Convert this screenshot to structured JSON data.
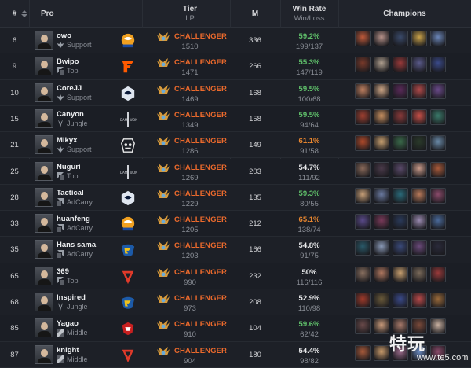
{
  "header": {
    "rank": "#",
    "pro": "Pro",
    "tier": "Tier",
    "tier_sub": "LP",
    "m": "M",
    "winrate": "Win Rate",
    "winrate_sub": "Win/Loss",
    "champions": "Champions"
  },
  "colors": {
    "challenger": "#ec6a2c",
    "green": "#5fbf6a",
    "orange": "#e8862f",
    "white": "#e7e8ea"
  },
  "rows": [
    {
      "rank": "6",
      "name": "owo",
      "role": "Support",
      "role_icon": "support-icon",
      "team_icon": "suning-logo-icon",
      "tier": "CHALLENGER",
      "lp": "1510",
      "m": "336",
      "wr": "59.2%",
      "wl": "199/137",
      "wr_color": "green",
      "champs": [
        "#c05a3a",
        "#b7928a",
        "#3a4a6a",
        "#c9a24a",
        "#6b86b8"
      ]
    },
    {
      "rank": "9",
      "name": "Bwipo",
      "role": "Top",
      "role_icon": "top-icon",
      "team_icon": "fnatic-logo-icon",
      "tier": "CHALLENGER",
      "lp": "1471",
      "m": "266",
      "wr": "55.3%",
      "wl": "147/119",
      "wr_color": "green",
      "champs": [
        "#7a3a2a",
        "#b0a090",
        "#9a3a3a",
        "#5a5a8a",
        "#3a4a8a"
      ]
    },
    {
      "rank": "10",
      "name": "CoreJJ",
      "role": "Support",
      "role_icon": "support-icon",
      "team_icon": "liquid-logo-icon",
      "tier": "CHALLENGER",
      "lp": "1469",
      "m": "168",
      "wr": "59.5%",
      "wl": "100/68",
      "wr_color": "green",
      "champs": [
        "#c08060",
        "#d0a888",
        "#5a2a5a",
        "#b04a4a",
        "#6a4a8a"
      ]
    },
    {
      "rank": "15",
      "name": "Canyon",
      "role": "Jungle",
      "role_icon": "jungle-icon",
      "team_icon": "damwon-logo-icon",
      "tier": "CHALLENGER",
      "lp": "1349",
      "m": "158",
      "wr": "59.5%",
      "wl": "94/64",
      "wr_color": "green",
      "champs": [
        "#a04030",
        "#c89060",
        "#8a3a3a",
        "#c85048",
        "#3a7a6a"
      ]
    },
    {
      "rank": "21",
      "name": "Mikyx",
      "role": "Support",
      "role_icon": "support-icon",
      "team_icon": "g2-logo-icon",
      "tier": "CHALLENGER",
      "lp": "1286",
      "m": "149",
      "wr": "61.1%",
      "wl": "91/58",
      "wr_color": "orange",
      "champs": [
        "#b04a2a",
        "#c8a070",
        "#3a6a4a",
        "#2a3a2a",
        "#6a8aa8"
      ]
    },
    {
      "rank": "25",
      "name": "Nuguri",
      "role": "Top",
      "role_icon": "top-icon",
      "team_icon": "damwon-logo-icon",
      "tier": "CHALLENGER",
      "lp": "1269",
      "m": "203",
      "wr": "54.7%",
      "wl": "111/92",
      "wr_color": "white",
      "champs": [
        "#8a6a5a",
        "#4a3a4a",
        "#5a4a6a",
        "#c89a8a",
        "#a85a3a"
      ]
    },
    {
      "rank": "28",
      "name": "Tactical",
      "role": "AdCarry",
      "role_icon": "adcarry-icon",
      "team_icon": "liquid-logo-icon",
      "tier": "CHALLENGER",
      "lp": "1229",
      "m": "135",
      "wr": "59.3%",
      "wl": "80/55",
      "wr_color": "green",
      "champs": [
        "#c8a078",
        "#6a7aa0",
        "#2a6a7a",
        "#b87a5a",
        "#8a4a6a"
      ]
    },
    {
      "rank": "33",
      "name": "huanfeng",
      "role": "AdCarry",
      "role_icon": "adcarry-icon",
      "team_icon": "suning-logo-icon",
      "tier": "CHALLENGER",
      "lp": "1205",
      "m": "212",
      "wr": "65.1%",
      "wl": "138/74",
      "wr_color": "orange",
      "champs": [
        "#5a4a8a",
        "#7a3a5a",
        "#2a3a5a",
        "#9a8ab0",
        "#4a6a9a"
      ]
    },
    {
      "rank": "35",
      "name": "Hans sama",
      "role": "AdCarry",
      "role_icon": "adcarry-icon",
      "team_icon": "rogue-logo-icon",
      "tier": "CHALLENGER",
      "lp": "1203",
      "m": "166",
      "wr": "54.8%",
      "wl": "91/75",
      "wr_color": "white",
      "champs": [
        "#2a5a6a",
        "#8a9ab8",
        "#3a4a7a",
        "#6a4a7a",
        "#2a2a3a"
      ]
    },
    {
      "rank": "65",
      "name": "369",
      "role": "Top",
      "role_icon": "top-icon",
      "team_icon": "tes-logo-icon",
      "tier": "CHALLENGER",
      "lp": "990",
      "m": "232",
      "wr": "50%",
      "wl": "116/116",
      "wr_color": "white",
      "champs": [
        "#8a7060",
        "#b07860",
        "#c8a070",
        "#7a6a5a",
        "#9a3a3a"
      ]
    },
    {
      "rank": "68",
      "name": "Inspired",
      "role": "Jungle",
      "role_icon": "jungle-icon",
      "team_icon": "rogue-logo-icon",
      "tier": "CHALLENGER",
      "lp": "973",
      "m": "208",
      "wr": "52.9%",
      "wl": "110/98",
      "wr_color": "white",
      "champs": [
        "#a03a2a",
        "#6a5a3a",
        "#3a4a8a",
        "#b84a4a",
        "#9a6a3a"
      ]
    },
    {
      "rank": "85",
      "name": "Yagao",
      "role": "Middle",
      "role_icon": "middle-icon",
      "team_icon": "jdg-logo-icon",
      "tier": "CHALLENGER",
      "lp": "910",
      "m": "104",
      "wr": "59.6%",
      "wl": "62/42",
      "wr_color": "green",
      "champs": [
        "#6a4a4a",
        "#c89a7a",
        "#a87a6a",
        "#7a4a3a",
        "#c8b0a0"
      ]
    },
    {
      "rank": "87",
      "name": "knight",
      "role": "Middle",
      "role_icon": "middle-icon",
      "team_icon": "tes-logo-icon",
      "tier": "CHALLENGER",
      "lp": "904",
      "m": "180",
      "wr": "54.4%",
      "wl": "98/82",
      "wr_color": "white",
      "champs": [
        "#a85a3a",
        "#c89a6a",
        "#9a6a8a",
        "#6a8ac0",
        "#8a4a6a"
      ]
    }
  ],
  "watermark": {
    "brand": "特玩",
    "url": "www.te5.com"
  }
}
